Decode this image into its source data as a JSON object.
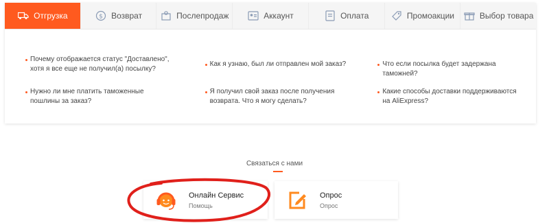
{
  "tabs": [
    {
      "label": "Отгрузка",
      "icon": "truck-icon",
      "active": true
    },
    {
      "label": "Возврат",
      "icon": "refund-icon",
      "active": false
    },
    {
      "label": "Послепродаж",
      "icon": "after-sale-icon",
      "active": false
    },
    {
      "label": "Аккаунт",
      "icon": "account-icon",
      "active": false
    },
    {
      "label": "Оплата",
      "icon": "payment-icon",
      "active": false
    },
    {
      "label": "Промоакции",
      "icon": "tag-icon",
      "active": false
    },
    {
      "label": "Выбор товара",
      "icon": "gift-icon",
      "active": false
    }
  ],
  "faq": {
    "row1": [
      "Почему отображается статус \"Доставлено\", хотя я все еще не получил(а) посылку?",
      "Как я узнаю, был ли отправлен мой заказ?",
      "Что если посылка будет задержана таможней?"
    ],
    "row2": [
      "Нужно ли мне платить таможенные пошлины за заказ?",
      "Я получил свой заказ после получения возврата. Что я могу сделать?",
      "Какие способы доставки поддерживаются на AliExpress?"
    ]
  },
  "contact": {
    "title": "Связаться с нами",
    "online": {
      "title": "Онлайн Сервис",
      "subtitle": "Помощь",
      "icon": "headset-agent-icon"
    },
    "survey": {
      "title": "Опрос",
      "subtitle": "Опрос",
      "icon": "edit-survey-icon"
    }
  },
  "colors": {
    "accent": "#ff5a1f",
    "annotation": "#e0201b"
  }
}
